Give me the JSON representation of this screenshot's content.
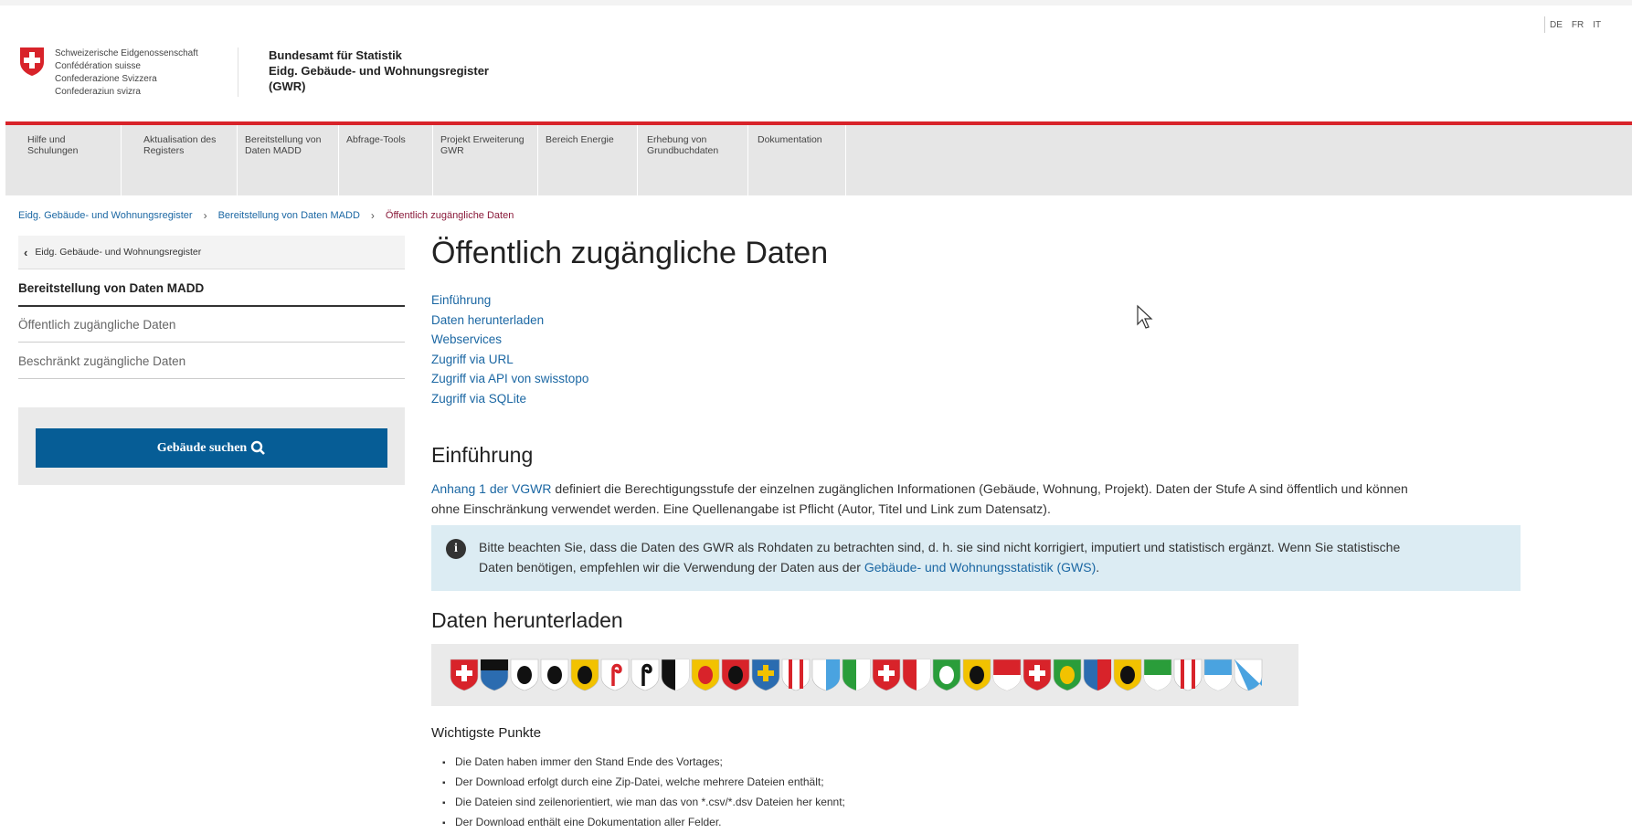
{
  "header": {
    "confed_lines": [
      "Schweizerische Eidgenossenschaft",
      "Confédération suisse",
      "Confederazione Svizzera",
      "Confederaziun svizra"
    ],
    "office_lines": [
      "Bundesamt für Statistik",
      "Eidg. Gebäude- und Wohnungsregister",
      "(GWR)"
    ],
    "languages": [
      "DE",
      "FR",
      "IT"
    ]
  },
  "nav": {
    "items": [
      "Hilfe und Schulungen",
      "Aktualisation des Registers",
      "Bereitstellung von Daten MADD",
      "Abfrage-Tools",
      "Projekt Erweiterung GWR",
      "Bereich Energie",
      "Erhebung von Grundbuchdaten",
      "Dokumentation"
    ]
  },
  "breadcrumb": [
    "Eidg. Gebäude- und Wohnungsregister",
    "Bereitstellung von Daten MADD",
    "Öffentlich zugängliche Daten"
  ],
  "sidebar": {
    "back_label": "Eidg. Gebäude- und Wohnungsregister",
    "section": "Bereitstellung von Daten MADD",
    "items": [
      "Öffentlich zugängliche Daten",
      "Beschränkt zugängliche Daten"
    ],
    "search_button": "Gebäude suchen"
  },
  "main": {
    "title": "Öffentlich zugängliche Daten",
    "toc": [
      "Einführung",
      "Daten herunterladen",
      "Webservices",
      "Zugriff via URL",
      "Zugriff via API von swisstopo",
      "Zugriff via SQLite"
    ],
    "intro_heading": "Einführung",
    "intro_link": "Anhang 1 der VGWR",
    "intro_text_1": " definiert die Berechtigungsstufe der einzelnen zugänglichen Informationen (Gebäude, Wohnung, Projekt). Daten der Stufe A sind öffentlich und können",
    "intro_text_2": "ohne Einschränkung verwendet werden. Eine Quellenangabe ist Pflicht (Autor, Titel und Link zum Datensatz).",
    "info_text_1": "Bitte beachten Sie, dass die Daten des GWR als Rohdaten zu betrachten sind, d. h. sie sind nicht korrigiert, imputiert und statistisch ergänzt. Wenn Sie statistische",
    "info_text_2": "Daten benötigen, empfehlen wir die Verwendung der Daten aus der ",
    "info_link": "Gebäude- und Wohnungsstatistik (GWS)",
    "info_text_3": ".",
    "download_heading": "Daten herunterladen",
    "points_heading": "Wichtigste Punkte",
    "points": [
      "Die Daten haben immer den Stand Ende des Vortages;",
      "Der Download erfolgt durch eine Zip-Datei, welche mehrere Dateien enthält;",
      "Die Dateien sind zeilenorientiert, wie man das von *.csv/*.dsv Dateien her kennt;",
      "Der Download enthält eine Dokumentation aller Felder."
    ]
  },
  "colors": {
    "link": "#1b67a3",
    "accent_red": "#d8232a",
    "button": "#065d96",
    "info_bg": "#dcecf3"
  },
  "icons": [
    "swiss-cross-icon",
    "chevron-left-icon",
    "search-icon",
    "info-icon",
    "mouse-cursor-icon"
  ]
}
